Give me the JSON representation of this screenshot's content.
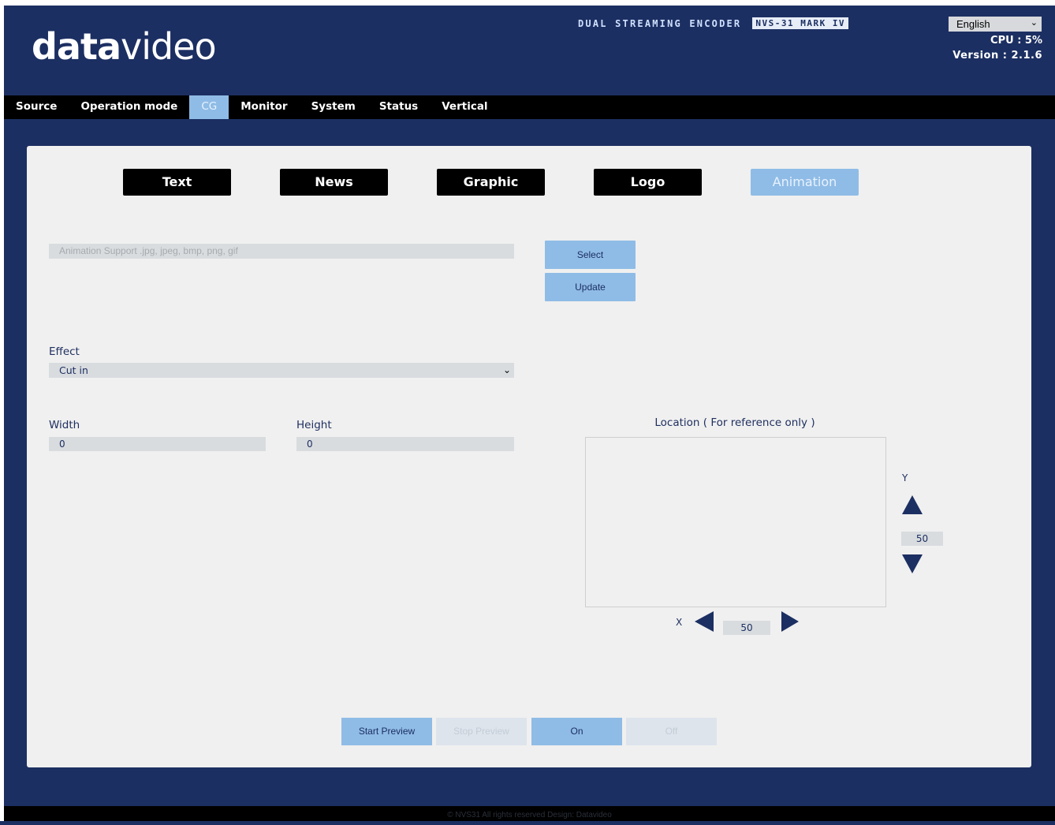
{
  "header": {
    "logo_bold": "data",
    "logo_light": "video",
    "product_name": "DUAL STREAMING ENCODER",
    "model": "NVS-31 MARK IV",
    "language": "English",
    "cpu": "CPU  : 5%",
    "version": "Version : 2.1.6"
  },
  "nav": {
    "tabs": [
      {
        "label": "Source"
      },
      {
        "label": "Operation mode"
      },
      {
        "label": "CG"
      },
      {
        "label": "Monitor"
      },
      {
        "label": "System"
      },
      {
        "label": "Status"
      },
      {
        "label": "Vertical"
      }
    ],
    "active": "CG"
  },
  "cg_tabs": {
    "tabs": [
      {
        "label": "Text"
      },
      {
        "label": "News"
      },
      {
        "label": "Graphic"
      },
      {
        "label": "Logo"
      },
      {
        "label": "Animation"
      }
    ],
    "active": "Animation"
  },
  "file": {
    "placeholder": "Animation Support .jpg, jpeg, bmp, png, gif",
    "select_label": "Select",
    "update_label": "Update"
  },
  "effect": {
    "label": "Effect",
    "value": "Cut in"
  },
  "size": {
    "width_label": "Width",
    "width_value": "0",
    "height_label": "Height",
    "height_value": "0"
  },
  "location": {
    "title": "Location ( For reference only )",
    "y_label": "Y",
    "y_value": "50",
    "x_label": "X",
    "x_value": "50"
  },
  "actions": {
    "start_preview": "Start Preview",
    "stop_preview": "Stop Preview",
    "on": "On",
    "off": "Off"
  },
  "footer": {
    "text": "© NVS31 All rights reserved Design: Datavideo"
  }
}
